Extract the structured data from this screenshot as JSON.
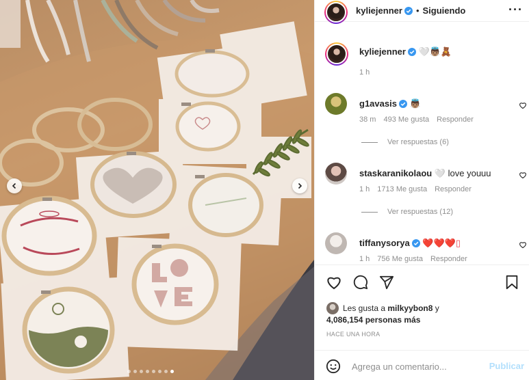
{
  "post": {
    "image_dots": 8,
    "active_dot": 7
  },
  "header": {
    "username": "kyliejenner",
    "separator": "•",
    "follow_status": "Siguiendo",
    "more_icon": "more-horizontal-icon"
  },
  "caption": {
    "username": "kyliejenner",
    "text": "🤍👼🏽🧸",
    "time": "1 h"
  },
  "comments": [
    {
      "username": "g1avasis",
      "text": "👼🏽",
      "time": "38 m",
      "likes": "493 Me gusta",
      "reply_label": "Responder",
      "view_replies": "Ver respuestas (6)"
    },
    {
      "username": "staskaranikolaou",
      "text": "🤍 love youuu",
      "time": "1 h",
      "likes": "1713 Me gusta",
      "reply_label": "Responder",
      "view_replies": "Ver respuestas (12)"
    },
    {
      "username": "tiffanysorya",
      "text": "❤️❤️❤️▯",
      "time": "1 h",
      "likes": "756 Me gusta",
      "reply_label": "Responder"
    }
  ],
  "likes": {
    "prefix": "Les gusta a",
    "liker": "milkyybon8",
    "conj": "y",
    "count": "4,086,154 personas más"
  },
  "timestamp": "HACE UNA HORA",
  "comment_box": {
    "placeholder": "Agrega un comentario...",
    "publish_label": "Publicar"
  },
  "colors": {
    "verified": "#3897f0",
    "heart_red": "#ed4956",
    "publish_disabled": "#b2dffc"
  }
}
